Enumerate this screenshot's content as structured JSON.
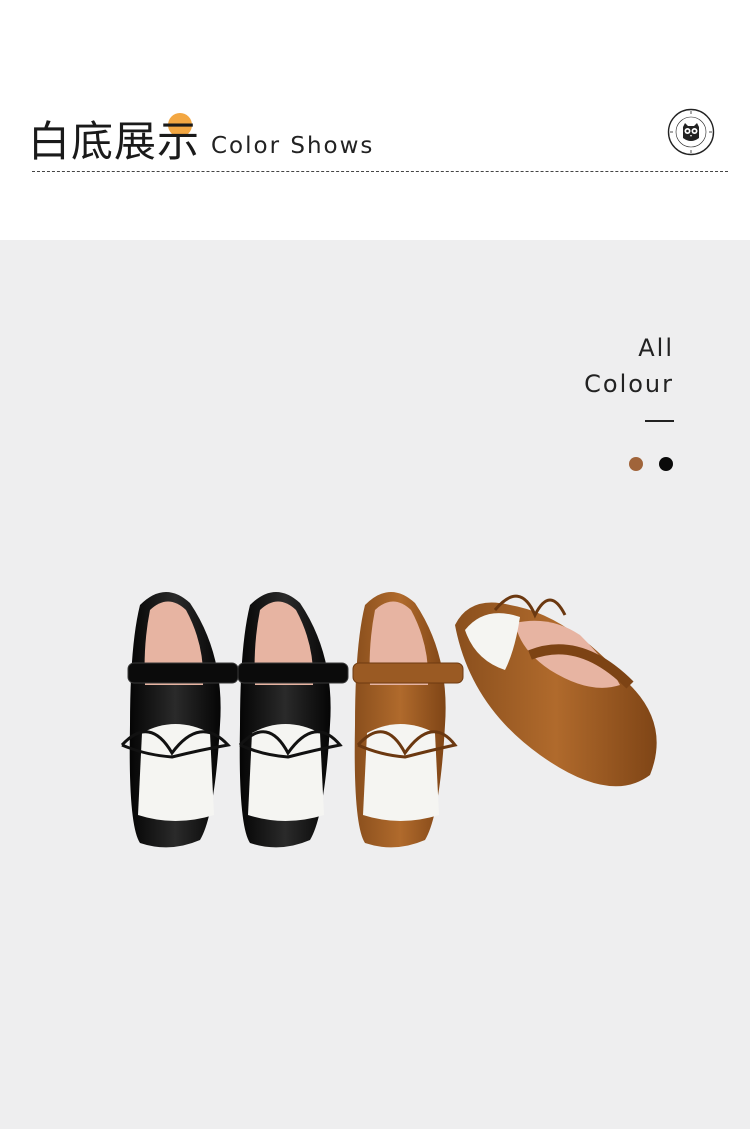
{
  "header": {
    "title_cn": "白底展示",
    "title_en": "Color Shows",
    "logo_icon": "mr-baby-owl-logo-icon",
    "accent_dot_color": "#f3a742"
  },
  "stage": {
    "label_line1": "All",
    "label_line2": "Colour",
    "swatches": [
      {
        "name": "brown",
        "color": "#a0643a"
      },
      {
        "name": "black",
        "color": "#0a0a0a"
      }
    ],
    "product": "shoes-photo"
  }
}
